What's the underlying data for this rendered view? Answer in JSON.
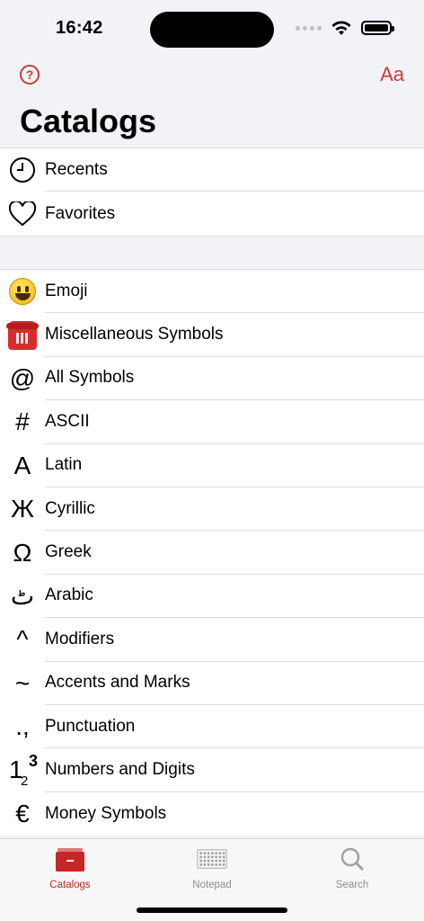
{
  "status": {
    "time": "16:42"
  },
  "nav": {
    "help_icon": "question-circle-icon",
    "help_label": "?",
    "font_label": "Aa",
    "title": "Catalogs"
  },
  "personal": [
    {
      "icon": "clock-icon",
      "label": "Recents"
    },
    {
      "icon": "heart-icon",
      "label": "Favorites"
    }
  ],
  "catalogs": [
    {
      "icon": "emoji-icon",
      "glyph": "",
      "label": "Emoji"
    },
    {
      "icon": "telephone-icon",
      "glyph": "",
      "label": "Miscellaneous Symbols"
    },
    {
      "icon": "at-sign-icon",
      "glyph": "@",
      "label": "All Symbols"
    },
    {
      "icon": "hash-icon",
      "glyph": "#",
      "label": "ASCII"
    },
    {
      "icon": "latin-a-icon",
      "glyph": "A",
      "label": "Latin"
    },
    {
      "icon": "cyrillic-zhe-icon",
      "glyph": "Ж",
      "label": "Cyrillic"
    },
    {
      "icon": "greek-omega-icon",
      "glyph": "Ω",
      "label": "Greek"
    },
    {
      "icon": "arabic-letter-icon",
      "glyph": "ٹ",
      "label": "Arabic"
    },
    {
      "icon": "caret-icon",
      "glyph": "^",
      "label": "Modifiers"
    },
    {
      "icon": "tilde-icon",
      "glyph": "~",
      "label": "Accents and Marks"
    },
    {
      "icon": "punctuation-icon",
      "glyph": ".,",
      "label": "Punctuation"
    },
    {
      "icon": "numbers-icon",
      "glyph": "",
      "label": "Numbers and Digits"
    },
    {
      "icon": "euro-icon",
      "glyph": "€",
      "label": "Money Symbols"
    }
  ],
  "number_icon": {
    "a": "1",
    "b": "2",
    "c": "3"
  },
  "tabs": [
    {
      "icon": "catalogs-tab-icon",
      "label": "Catalogs",
      "active": true
    },
    {
      "icon": "notepad-tab-icon",
      "label": "Notepad",
      "active": false
    },
    {
      "icon": "search-tab-icon",
      "label": "Search",
      "active": false
    }
  ],
  "colors": {
    "accent": "#d03a3a",
    "tab_active": "#c62828",
    "tab_inactive": "#8e8e93"
  }
}
